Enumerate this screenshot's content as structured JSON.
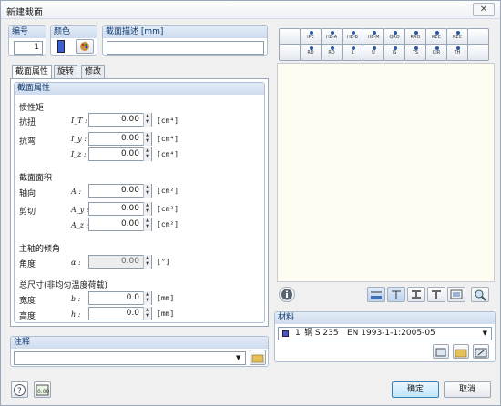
{
  "window": {
    "title": "新建截面",
    "close": "✕"
  },
  "top": {
    "no_label": "编号",
    "no_value": "1",
    "color_label": "颜色",
    "desc_label": "截面描述 [mm]",
    "desc_value": ""
  },
  "tabs": [
    "截面属性",
    "旋转",
    "修改"
  ],
  "props": {
    "group_title": "截面属性",
    "inertia_title": "惯性矩",
    "torsion_label": "抗扭",
    "torsion_sym": "I_T :",
    "torsion_value": "0.00",
    "torsion_unit": "[cm⁴]",
    "bending_label": "抗弯",
    "iy_sym": "I_y :",
    "iy_value": "0.00",
    "iy_unit": "[cm⁴]",
    "iz_sym": "I_z :",
    "iz_value": "0.00",
    "iz_unit": "[cm⁴]",
    "area_title": "截面面积",
    "axial_label": "轴向",
    "a_sym": "A :",
    "a_value": "0.00",
    "a_unit": "[cm²]",
    "shear_label": "剪切",
    "ay_sym": "A_y :",
    "ay_value": "0.00",
    "ay_unit": "[cm²]",
    "az_sym": "A_z :",
    "az_value": "0.00",
    "az_unit": "[cm²]",
    "principal_title": "主轴的倾角",
    "angle_label": "角度",
    "alpha_sym": "α :",
    "alpha_value": "0.00",
    "alpha_unit": "[°]",
    "dims_title": "总尺寸(非均匀温度荷载)",
    "width_label": "宽度",
    "b_sym": "b :",
    "b_value": "0.0",
    "b_unit": "[mm]",
    "height_label": "高度",
    "h_sym": "h :",
    "h_value": "0.0",
    "h_unit": "[mm]"
  },
  "shape_row1": [
    "",
    "IPE",
    "HE-A",
    "HE-B",
    "HE-M",
    "QRO",
    "RRO",
    "REC",
    "REC",
    ""
  ],
  "shape_row2": [
    "",
    "RD",
    "RD",
    "L",
    "U",
    "IS",
    "TS",
    "CIR",
    "TH",
    ""
  ],
  "comment": {
    "title": "注释",
    "value": ""
  },
  "material": {
    "title": "材料",
    "number": "1",
    "name": "钢 S 235",
    "standard": "EN 1993-1-1:2005-05"
  },
  "buttons": {
    "ok": "确定",
    "cancel": "取消"
  },
  "colors": {
    "accent": "#2a5cb8",
    "section_color": "#3a5fd0"
  }
}
